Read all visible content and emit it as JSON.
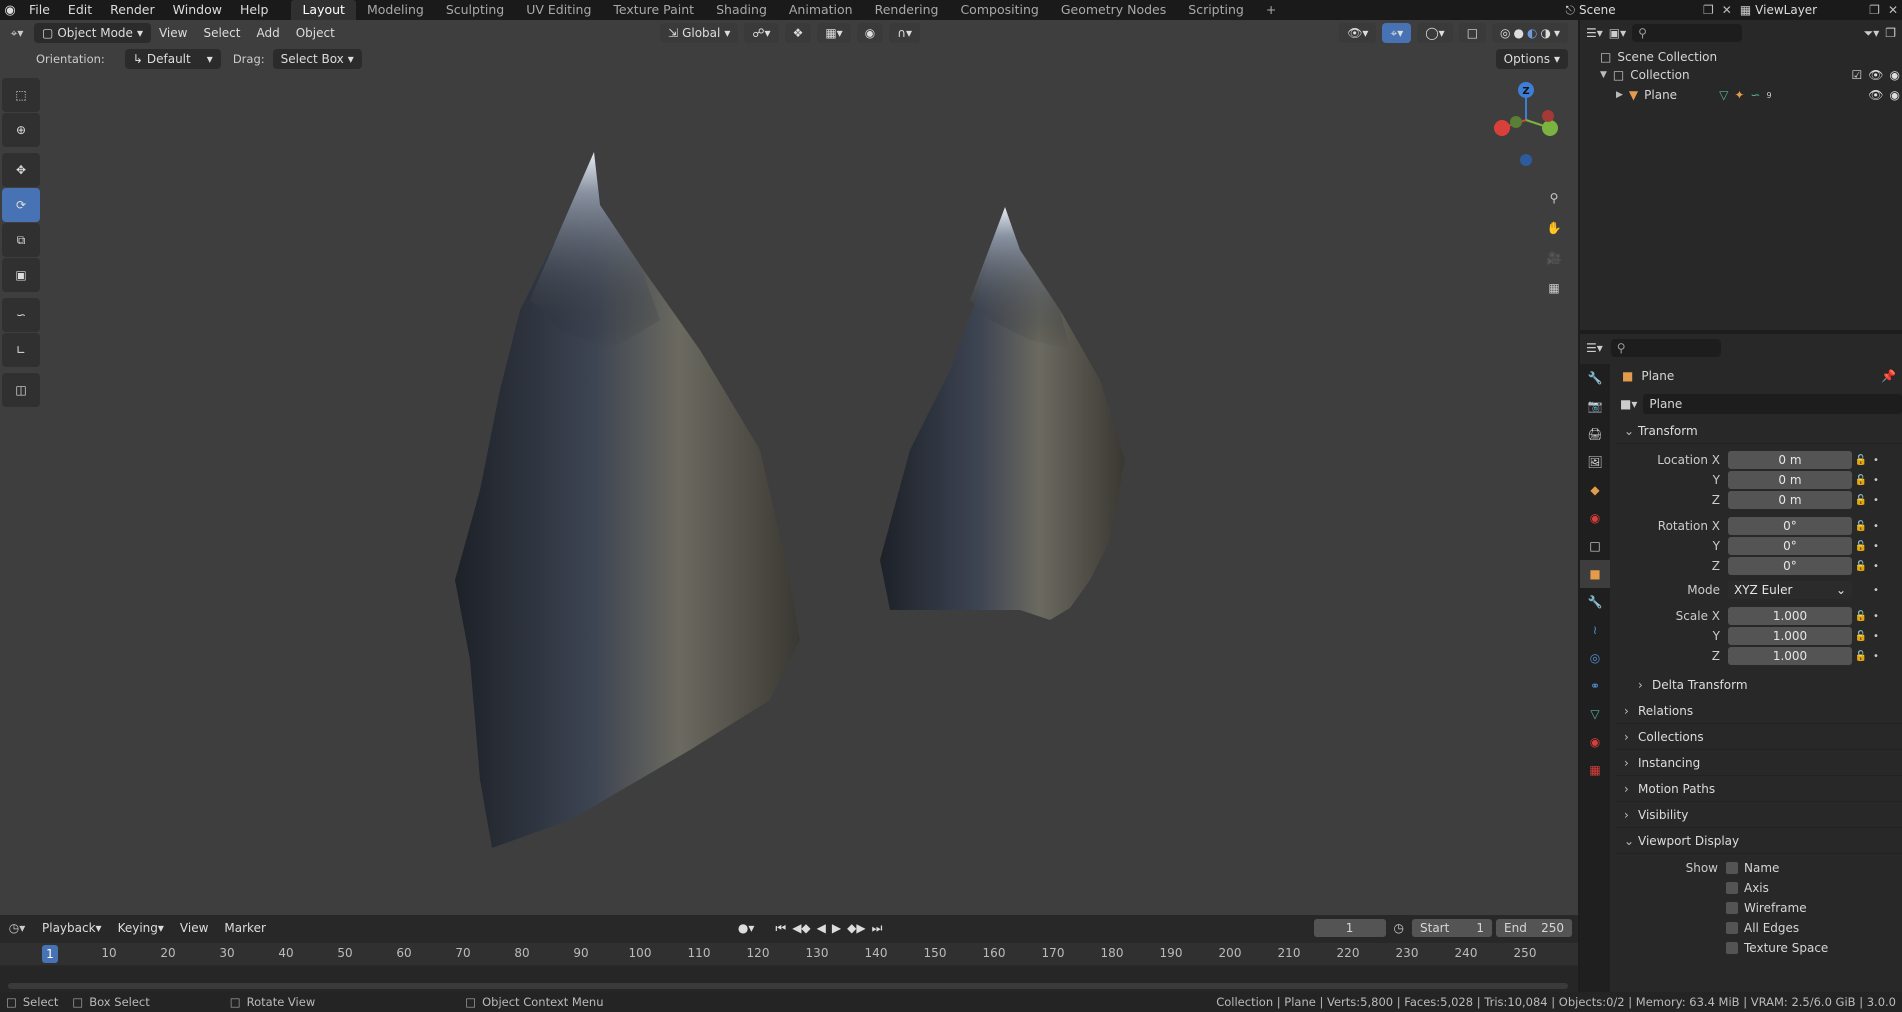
{
  "topbar": {
    "menus": [
      "File",
      "Edit",
      "Render",
      "Window",
      "Help"
    ],
    "workspaces": [
      "Layout",
      "Modeling",
      "Sculpting",
      "UV Editing",
      "Texture Paint",
      "Shading",
      "Animation",
      "Rendering",
      "Compositing",
      "Geometry Nodes",
      "Scripting"
    ],
    "active_workspace": "Layout",
    "add_tab": "+",
    "scene": "Scene",
    "view_layer": "ViewLayer"
  },
  "viewport_header": {
    "mode": "Object Mode",
    "menus": [
      "View",
      "Select",
      "Add",
      "Object"
    ],
    "transform_orientation": "Global",
    "options": "Options",
    "orientation_label": "Orientation:",
    "orientation_value": "Default",
    "drag_label": "Drag:",
    "drag_value": "Select Box"
  },
  "gizmo": {
    "z": "Z"
  },
  "outliner": {
    "root": "Scene Collection",
    "collection": "Collection",
    "object": "Plane",
    "modifier_count": "9"
  },
  "properties": {
    "object_name": "Plane",
    "data_name": "Plane",
    "transform": {
      "title": "Transform",
      "location_label": "Location X",
      "location": [
        "0 m",
        "0 m",
        "0 m"
      ],
      "rotation_label": "Rotation X",
      "rotation": [
        "0°",
        "0°",
        "0°"
      ],
      "mode_label": "Mode",
      "mode": "XYZ Euler",
      "scale_label": "Scale X",
      "scale": [
        "1.000",
        "1.000",
        "1.000"
      ],
      "y": "Y",
      "z": "Z"
    },
    "delta_transform": "Delta Transform",
    "sections": [
      "Relations",
      "Collections",
      "Instancing",
      "Motion Paths",
      "Visibility"
    ],
    "viewport_display": {
      "title": "Viewport Display",
      "show_label": "Show",
      "options": [
        "Name",
        "Axis",
        "Wireframe",
        "All Edges",
        "Texture Space"
      ]
    }
  },
  "timeline": {
    "menus": [
      "Playback",
      "Keying",
      "View",
      "Marker"
    ],
    "current_frame": "1",
    "start_label": "Start",
    "start": "1",
    "end_label": "End",
    "end": "250",
    "ruler": [
      "10",
      "20",
      "30",
      "40",
      "50",
      "60",
      "70",
      "80",
      "90",
      "100",
      "110",
      "120",
      "130",
      "140",
      "150",
      "160",
      "170",
      "180",
      "190",
      "200",
      "210",
      "220",
      "230",
      "240",
      "250"
    ],
    "playhead": "1"
  },
  "statusbar": {
    "select": "Select",
    "box_select": "Box Select",
    "rotate_view": "Rotate View",
    "context_menu": "Object Context Menu",
    "stats": "Collection | Plane | Verts:5,800 | Faces:5,028 | Tris:10,084 | Objects:0/2 | Memory: 63.4 MiB | VRAM: 2.5/6.0 GiB | 3.0.0"
  },
  "colors": {
    "accent": "#4772b3",
    "viewport_bg": "#3e3e3e",
    "panel_bg": "#282828",
    "field_bg": "#545454",
    "gizmo_x": "#d9403c",
    "gizmo_y": "#7ab340",
    "gizmo_z": "#3d7fd6"
  }
}
